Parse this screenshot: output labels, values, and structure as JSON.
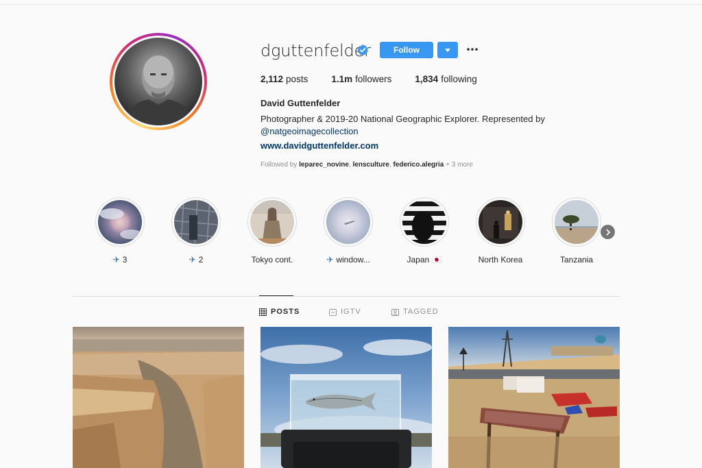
{
  "profile": {
    "username": "dguttenfelder",
    "follow_label": "Follow",
    "stats": [
      {
        "count": "2,112",
        "label": "posts"
      },
      {
        "count": "1.1m",
        "label": "followers"
      },
      {
        "count": "1,834",
        "label": "following"
      }
    ],
    "full_name": "David Guttenfelder",
    "bio": "Photographer & 2019-20 National Geographic Explorer. Represented by",
    "bio_mention": "@natgeoimagecollection",
    "website": "www.davidguttenfelder.com",
    "followed_by": {
      "prefix": "Followed by",
      "names": [
        "leparec_novine",
        "lensculture",
        "federico.alegria"
      ],
      "more": "+ 3 more"
    }
  },
  "highlights": [
    {
      "label": "3",
      "icon": "airplane-icon"
    },
    {
      "label": "2",
      "icon": "airplane-icon"
    },
    {
      "label": "Tokyo cont."
    },
    {
      "label": "window...",
      "icon": "airplane-icon"
    },
    {
      "label": "Japan 🇯🇵"
    },
    {
      "label": "North Korea"
    },
    {
      "label": "Tanzania"
    }
  ],
  "tabs": [
    {
      "label": "POSTS",
      "icon": "grid-icon",
      "active": true
    },
    {
      "label": "IGTV",
      "icon": "igtv-icon",
      "active": false
    },
    {
      "label": "TAGGED",
      "icon": "tagged-icon",
      "active": false
    }
  ],
  "colors": {
    "primary_button": "#3897f0",
    "link": "#00376b",
    "muted_text": "#8e8e8e",
    "background": "#fafafa"
  }
}
